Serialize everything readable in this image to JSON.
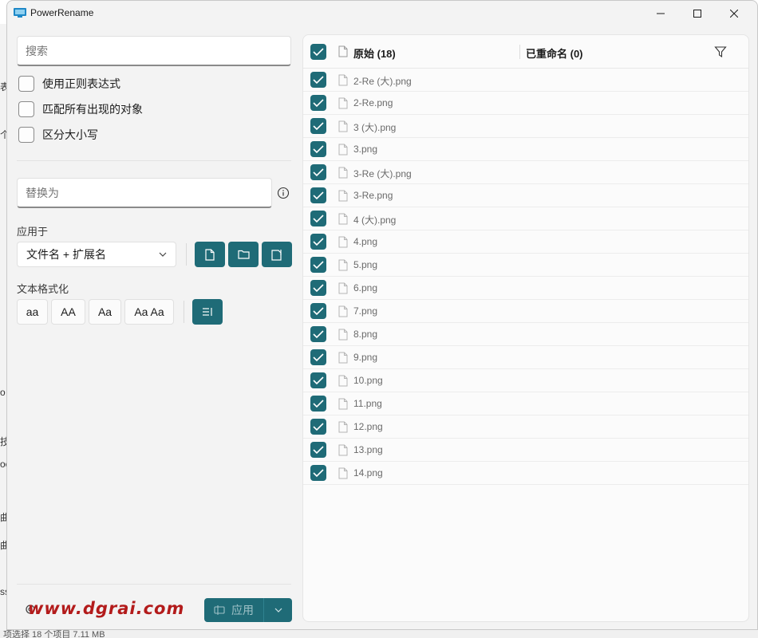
{
  "window": {
    "title": "PowerRename"
  },
  "left": {
    "search_placeholder": "搜索",
    "options": [
      {
        "label": "使用正则表达式"
      },
      {
        "label": "匹配所有出现的对象"
      },
      {
        "label": "区分大小写"
      }
    ],
    "replace_placeholder": "替换为",
    "apply_to_label": "应用于",
    "apply_to_value": "文件名 + 扩展名",
    "text_format_label": "文本格式化",
    "format_buttons": [
      "aa",
      "AA",
      "Aa",
      "Aa Aa"
    ],
    "apply_button": "应用"
  },
  "right": {
    "original_header": "原始 (18)",
    "renamed_header": "已重命名 (0)",
    "files": [
      "2-Re (大).png",
      "2-Re.png",
      "3 (大).png",
      "3.png",
      "3-Re (大).png",
      "3-Re.png",
      "4 (大).png",
      "4.png",
      "5.png",
      "6.png",
      "7.png",
      "8.png",
      "9.png",
      "10.png",
      "11.png",
      "12.png",
      "13.png",
      "14.png"
    ]
  },
  "watermark": "www.dgrai.com",
  "background_status": "项选择 18 个项目  7.11 MB",
  "colors": {
    "accent": "#1f6b77",
    "watermark": "#b31b1b"
  },
  "icons": [
    "gear-icon",
    "info-icon",
    "file-icon",
    "folder-icon",
    "filter-icon"
  ]
}
